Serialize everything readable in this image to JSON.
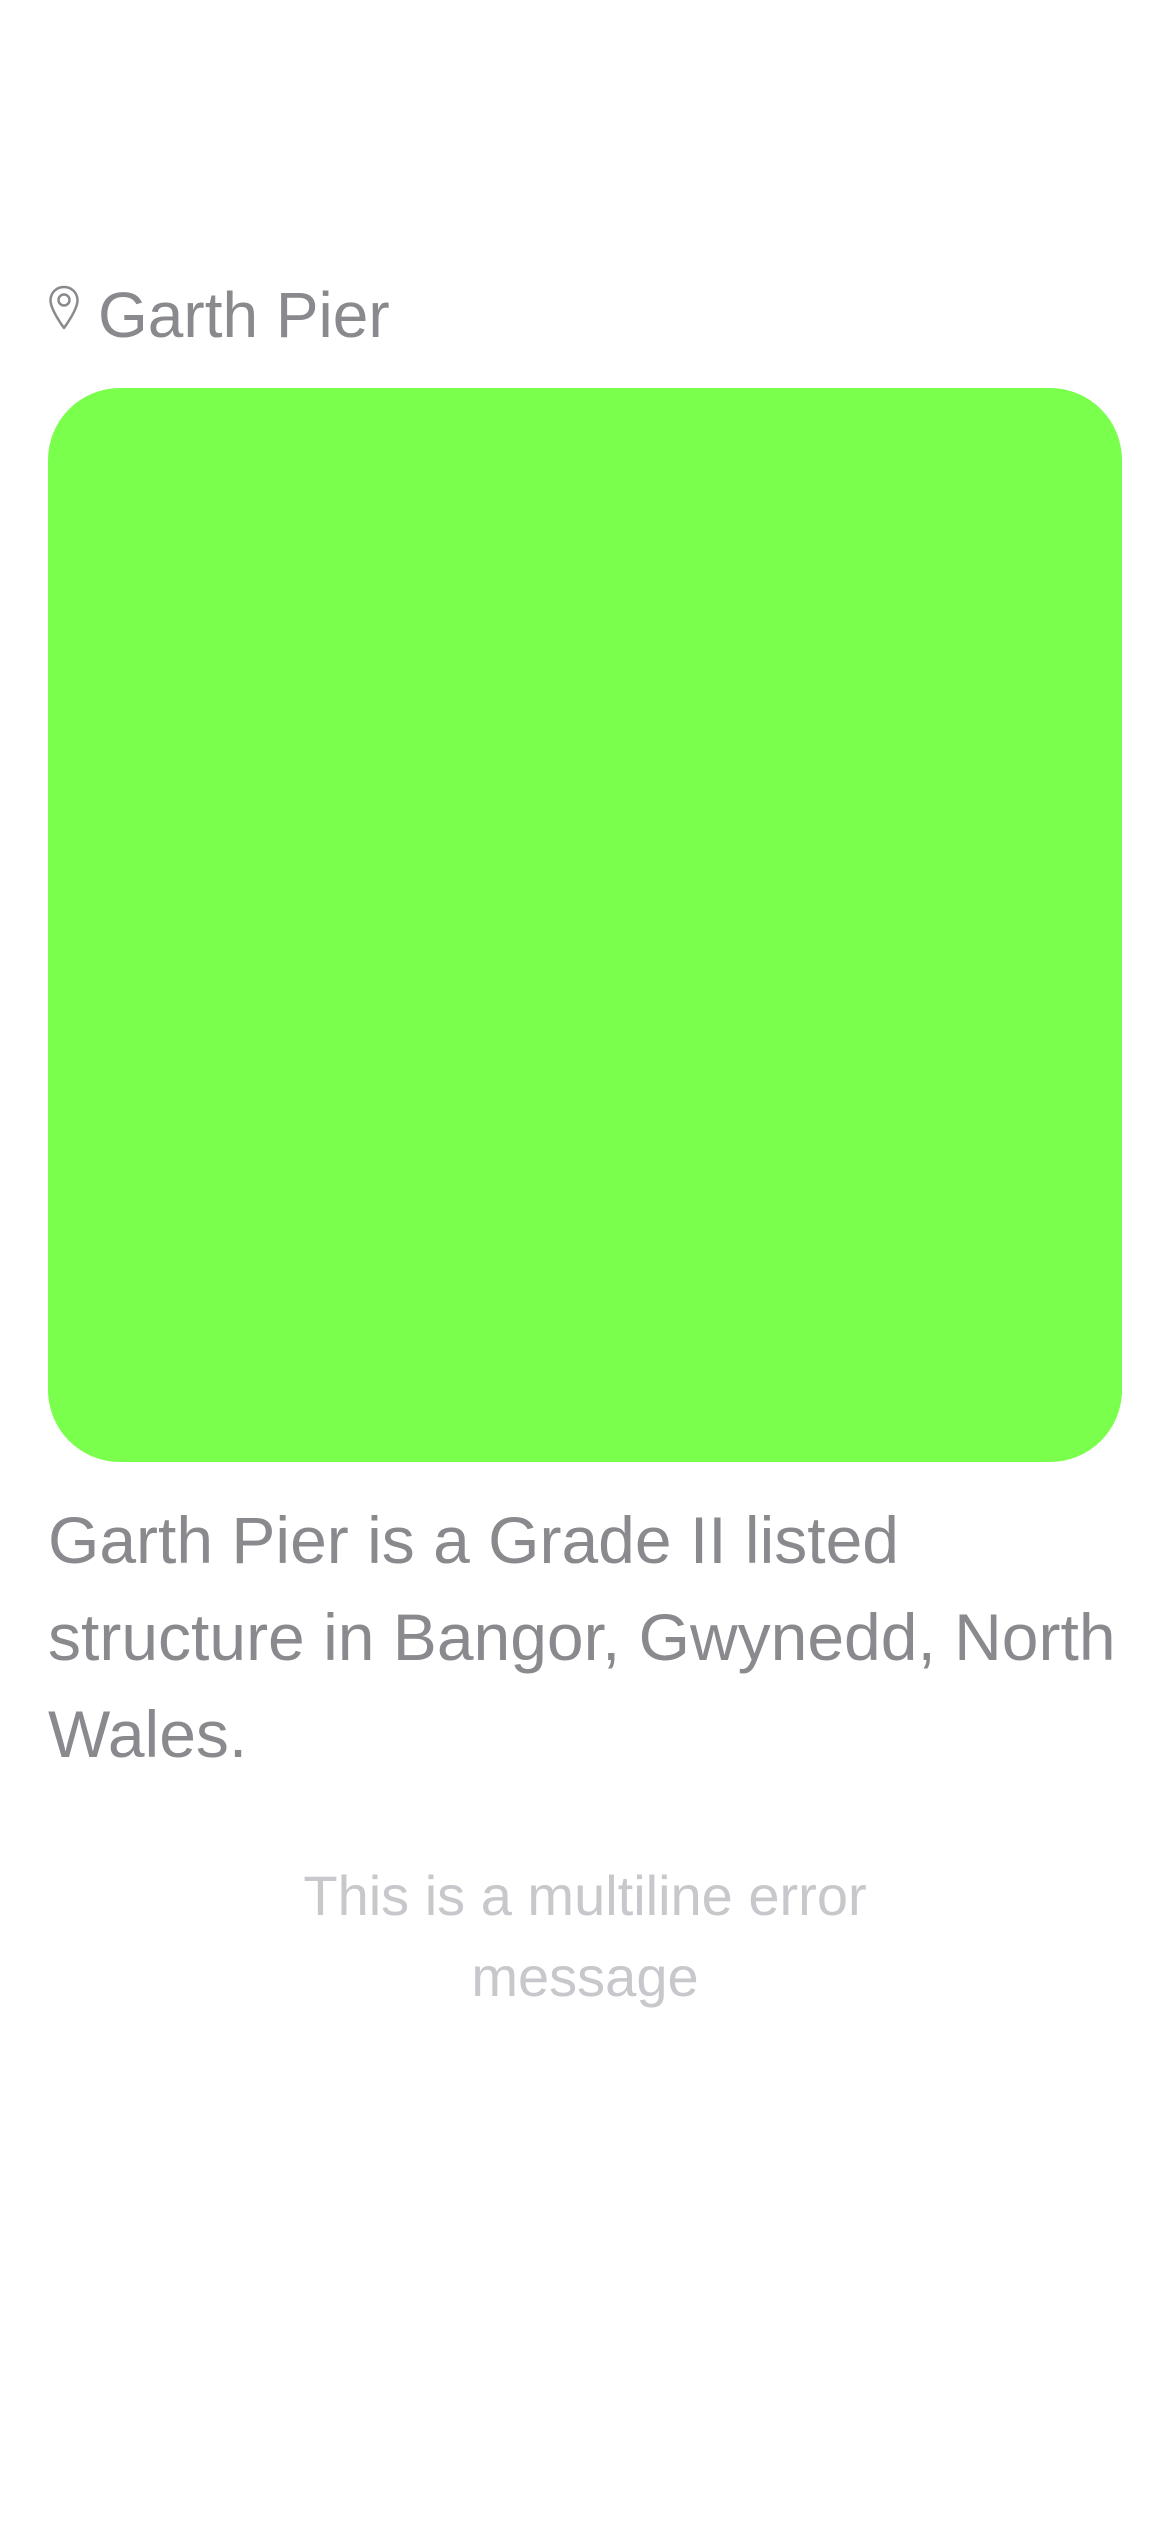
{
  "location": {
    "icon": "map-pin-icon",
    "name": "Garth Pier"
  },
  "card": {
    "color": "#7aff4d"
  },
  "description": "Garth Pier is a Grade II listed structure in Bangor, Gwynedd, North Wales.",
  "error": {
    "message": "This is a multiline error message"
  },
  "colors": {
    "primary_text": "#8a8a8e",
    "secondary_text": "#c7c7cc",
    "background": "#ffffff"
  }
}
